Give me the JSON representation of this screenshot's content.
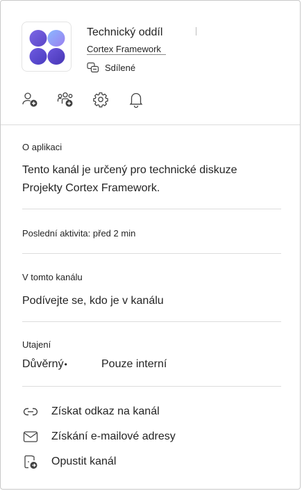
{
  "header": {
    "app_name": "Technický oddíl",
    "app_subtitle": "Cortex Framework",
    "shared_label": "Sdílené",
    "logo_icon": "four-blobs-logo",
    "logo_colors": [
      "#6a5bd6",
      "#8f7bf0",
      "#4f7be8",
      "#5a49c8"
    ]
  },
  "actions": [
    {
      "icon": "add-person-icon"
    },
    {
      "icon": "add-team-icon"
    },
    {
      "icon": "gear-icon"
    },
    {
      "icon": "bell-icon"
    }
  ],
  "about": {
    "label": "O aplikaci",
    "description_line1": "Tento kanál je určený pro technické diskuze",
    "description_line2": "Projekty Cortex Framework."
  },
  "activity": {
    "text": "Poslední aktivita: před 2 min"
  },
  "channel": {
    "label": "V tomto kanálu",
    "members_link": "Podívejte se, kdo je v kanálu"
  },
  "secrecy": {
    "label": "Utajení",
    "level": "Důvěrný",
    "bullet": "•",
    "scope": "Pouze interní"
  },
  "menu": [
    {
      "icon": "link-icon",
      "label": "Získat odkaz na kanál"
    },
    {
      "icon": "mail-icon",
      "label": "Získání e-mailové adresy"
    },
    {
      "icon": "leave-icon",
      "label": "Opustit kanál"
    }
  ]
}
